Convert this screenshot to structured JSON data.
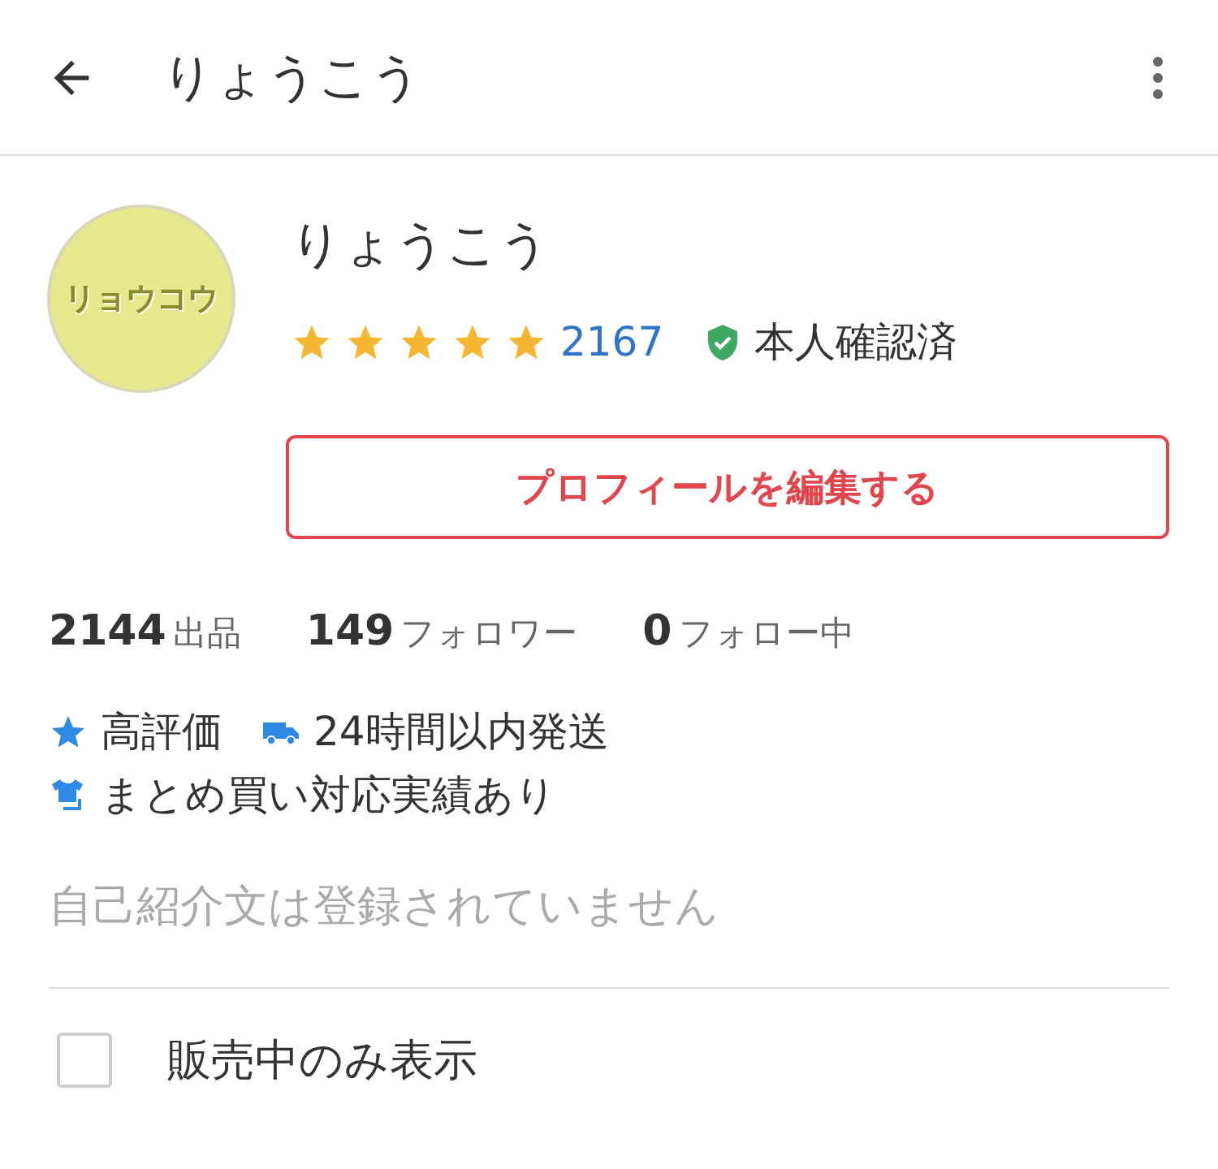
{
  "header": {
    "title": "りょうこう"
  },
  "profile": {
    "avatar_text": "リョウコウ",
    "name": "りょうこう",
    "stars": 5,
    "review_count": "2167",
    "verified_label": "本人確認済",
    "edit_button": "プロフィールを編集する"
  },
  "stats": [
    {
      "value": "2144",
      "label": "出品"
    },
    {
      "value": "149",
      "label": "フォロワー"
    },
    {
      "value": "0",
      "label": "フォロー中"
    }
  ],
  "badges": [
    {
      "kind": "star",
      "label": "高評価"
    },
    {
      "kind": "truck",
      "label": "24時間以内発送"
    },
    {
      "kind": "shirt",
      "label": "まとめ買い対応実績あり"
    }
  ],
  "bio": "自己紹介文は登録されていません",
  "filter": {
    "label": "販売中のみ表示",
    "checked": false
  }
}
